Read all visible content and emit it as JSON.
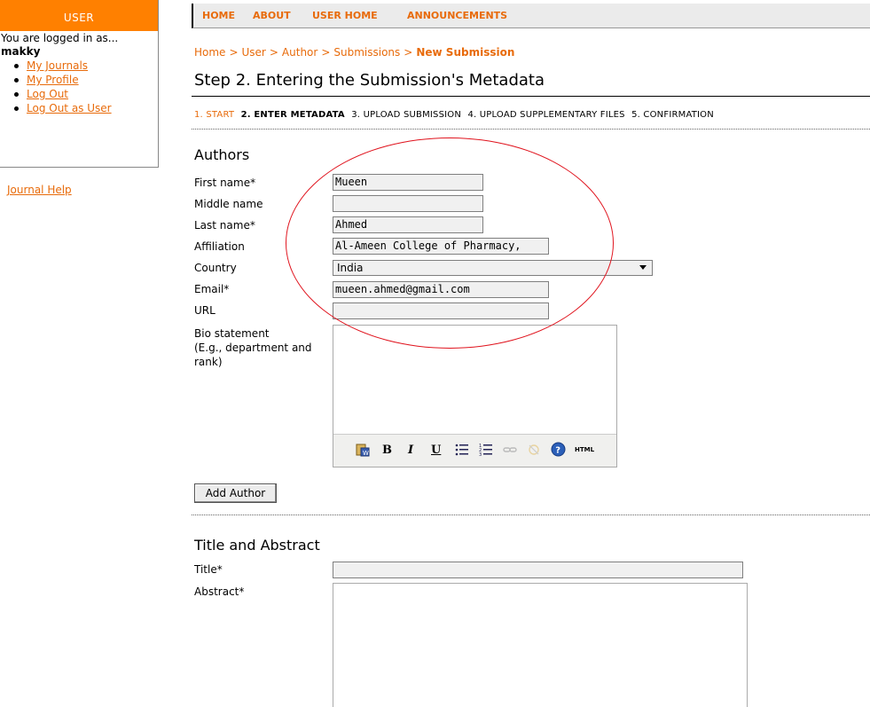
{
  "sidebar": {
    "heading": "USER",
    "logged_in_text": "You are logged in as...",
    "username": "makky",
    "links": [
      "My Journals",
      "My Profile",
      "Log Out",
      "Log Out as User"
    ],
    "help_link": "Journal Help"
  },
  "nav": {
    "items": [
      "HOME",
      "ABOUT",
      "USER HOME",
      "ANNOUNCEMENTS"
    ]
  },
  "breadcrumb": {
    "items": [
      "Home",
      "User",
      "Author",
      "Submissions"
    ],
    "separator": ">",
    "current": "New Submission"
  },
  "page_title": "Step 2. Entering the Submission's Metadata",
  "steps": {
    "items": [
      "1. START",
      "2. ENTER METADATA",
      "3. UPLOAD SUBMISSION",
      "4. UPLOAD SUPPLEMENTARY FILES",
      "5. CONFIRMATION"
    ]
  },
  "authors": {
    "section_title": "Authors",
    "labels": {
      "first_name": "First name*",
      "middle_name": "Middle name",
      "last_name": "Last name*",
      "affiliation": "Affiliation",
      "country": "Country",
      "email": "Email*",
      "url": "URL",
      "bio_line1": "Bio statement",
      "bio_line2": "(E.g., department and",
      "bio_line3": "rank)"
    },
    "values": {
      "first_name": "Mueen",
      "middle_name": "",
      "last_name": "Ahmed",
      "affiliation": "Al-Ameen College of Pharmacy,",
      "country": "India",
      "email": "mueen.ahmed@gmail.com",
      "url": ""
    },
    "toolbar": {
      "bold": "B",
      "italic": "I",
      "underline": "U",
      "html": "HTML"
    },
    "add_button": "Add Author"
  },
  "title_abstract": {
    "section_title": "Title and Abstract",
    "title_label": "Title*",
    "abstract_label": "Abstract*",
    "title_value": ""
  },
  "colors": {
    "accent": "#e86b0b",
    "sidebar_header": "#ff8000",
    "annotation": "#e0141e"
  }
}
